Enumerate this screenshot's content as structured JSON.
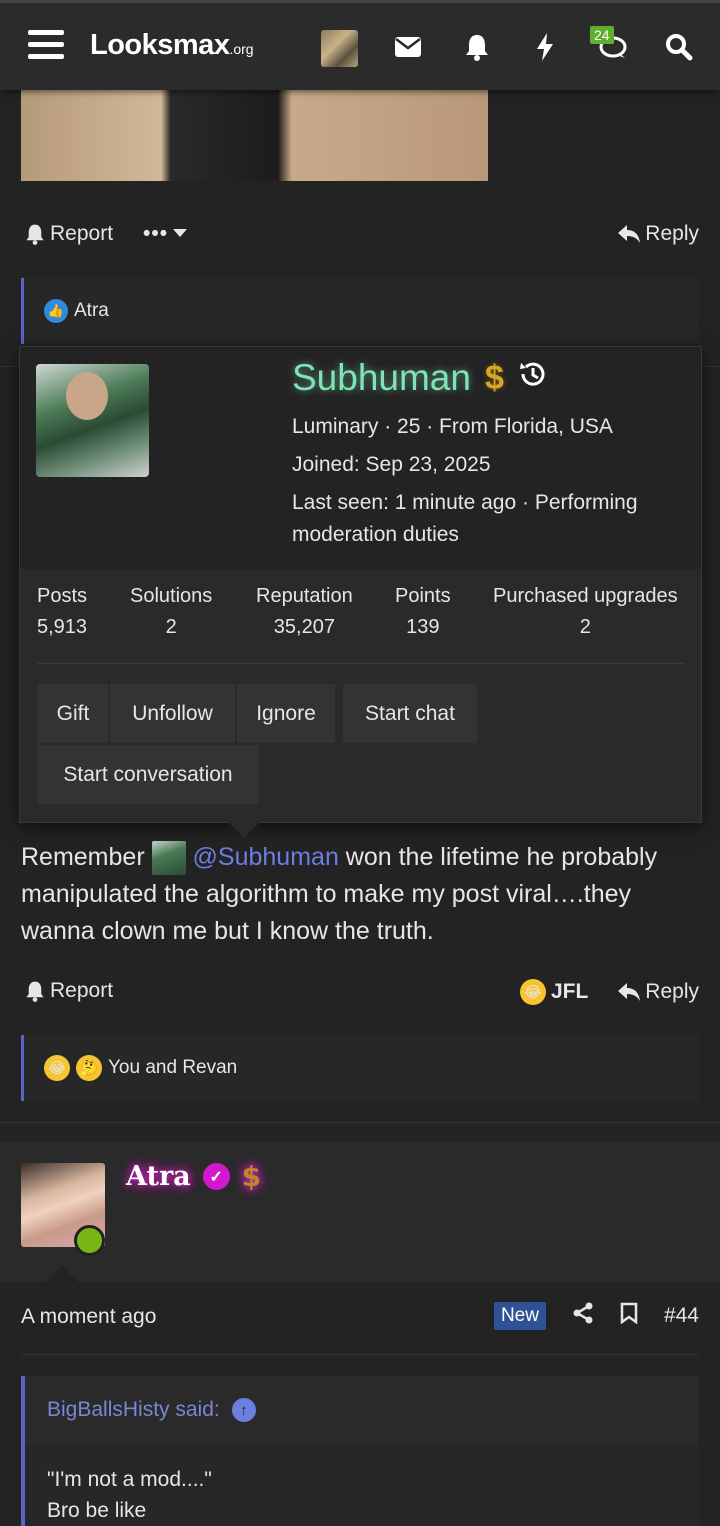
{
  "header": {
    "logo_main": "Looksmax",
    "logo_suffix": ".org",
    "messages_badge": "24"
  },
  "post1": {
    "report_label": "Report",
    "reply_label": "Reply",
    "reaction_text": "Atra"
  },
  "popup": {
    "name": "Subhuman",
    "info_line": "Luminary · 25 · From Florida, USA",
    "joined": "Joined: Sep 23, 2025",
    "last_seen": "Last seen: 1 minute ago · Performing moderation duties",
    "stats": [
      {
        "label": "Posts",
        "value": "5,913"
      },
      {
        "label": "Solutions",
        "value": "2"
      },
      {
        "label": "Reputation",
        "value": "35,207"
      },
      {
        "label": "Points",
        "value": "139"
      },
      {
        "label": "Purchased upgrades",
        "value": "2"
      }
    ],
    "buttons": {
      "gift": "Gift",
      "unfollow": "Unfollow",
      "ignore": "Ignore",
      "start_chat": "Start chat",
      "start_conversation": "Start conversation"
    }
  },
  "post2": {
    "text_before": "Remember ",
    "mention": "@Subhuman",
    "text_after": " won the lifetime he probably manipulated the algorithm to make my post viral….they wanna clown me but I know the truth.",
    "report_label": "Report",
    "jfl_label": "JFL",
    "reply_label": "Reply",
    "reaction_text": "You and Revan"
  },
  "post3": {
    "author": "Atra",
    "time": "A moment ago",
    "new_badge": "New",
    "post_number": "#44",
    "quote_author": "BigBallsHisty said:",
    "quote_line1": "\"I'm not a mod....\"",
    "quote_line2": "Bro be like"
  }
}
